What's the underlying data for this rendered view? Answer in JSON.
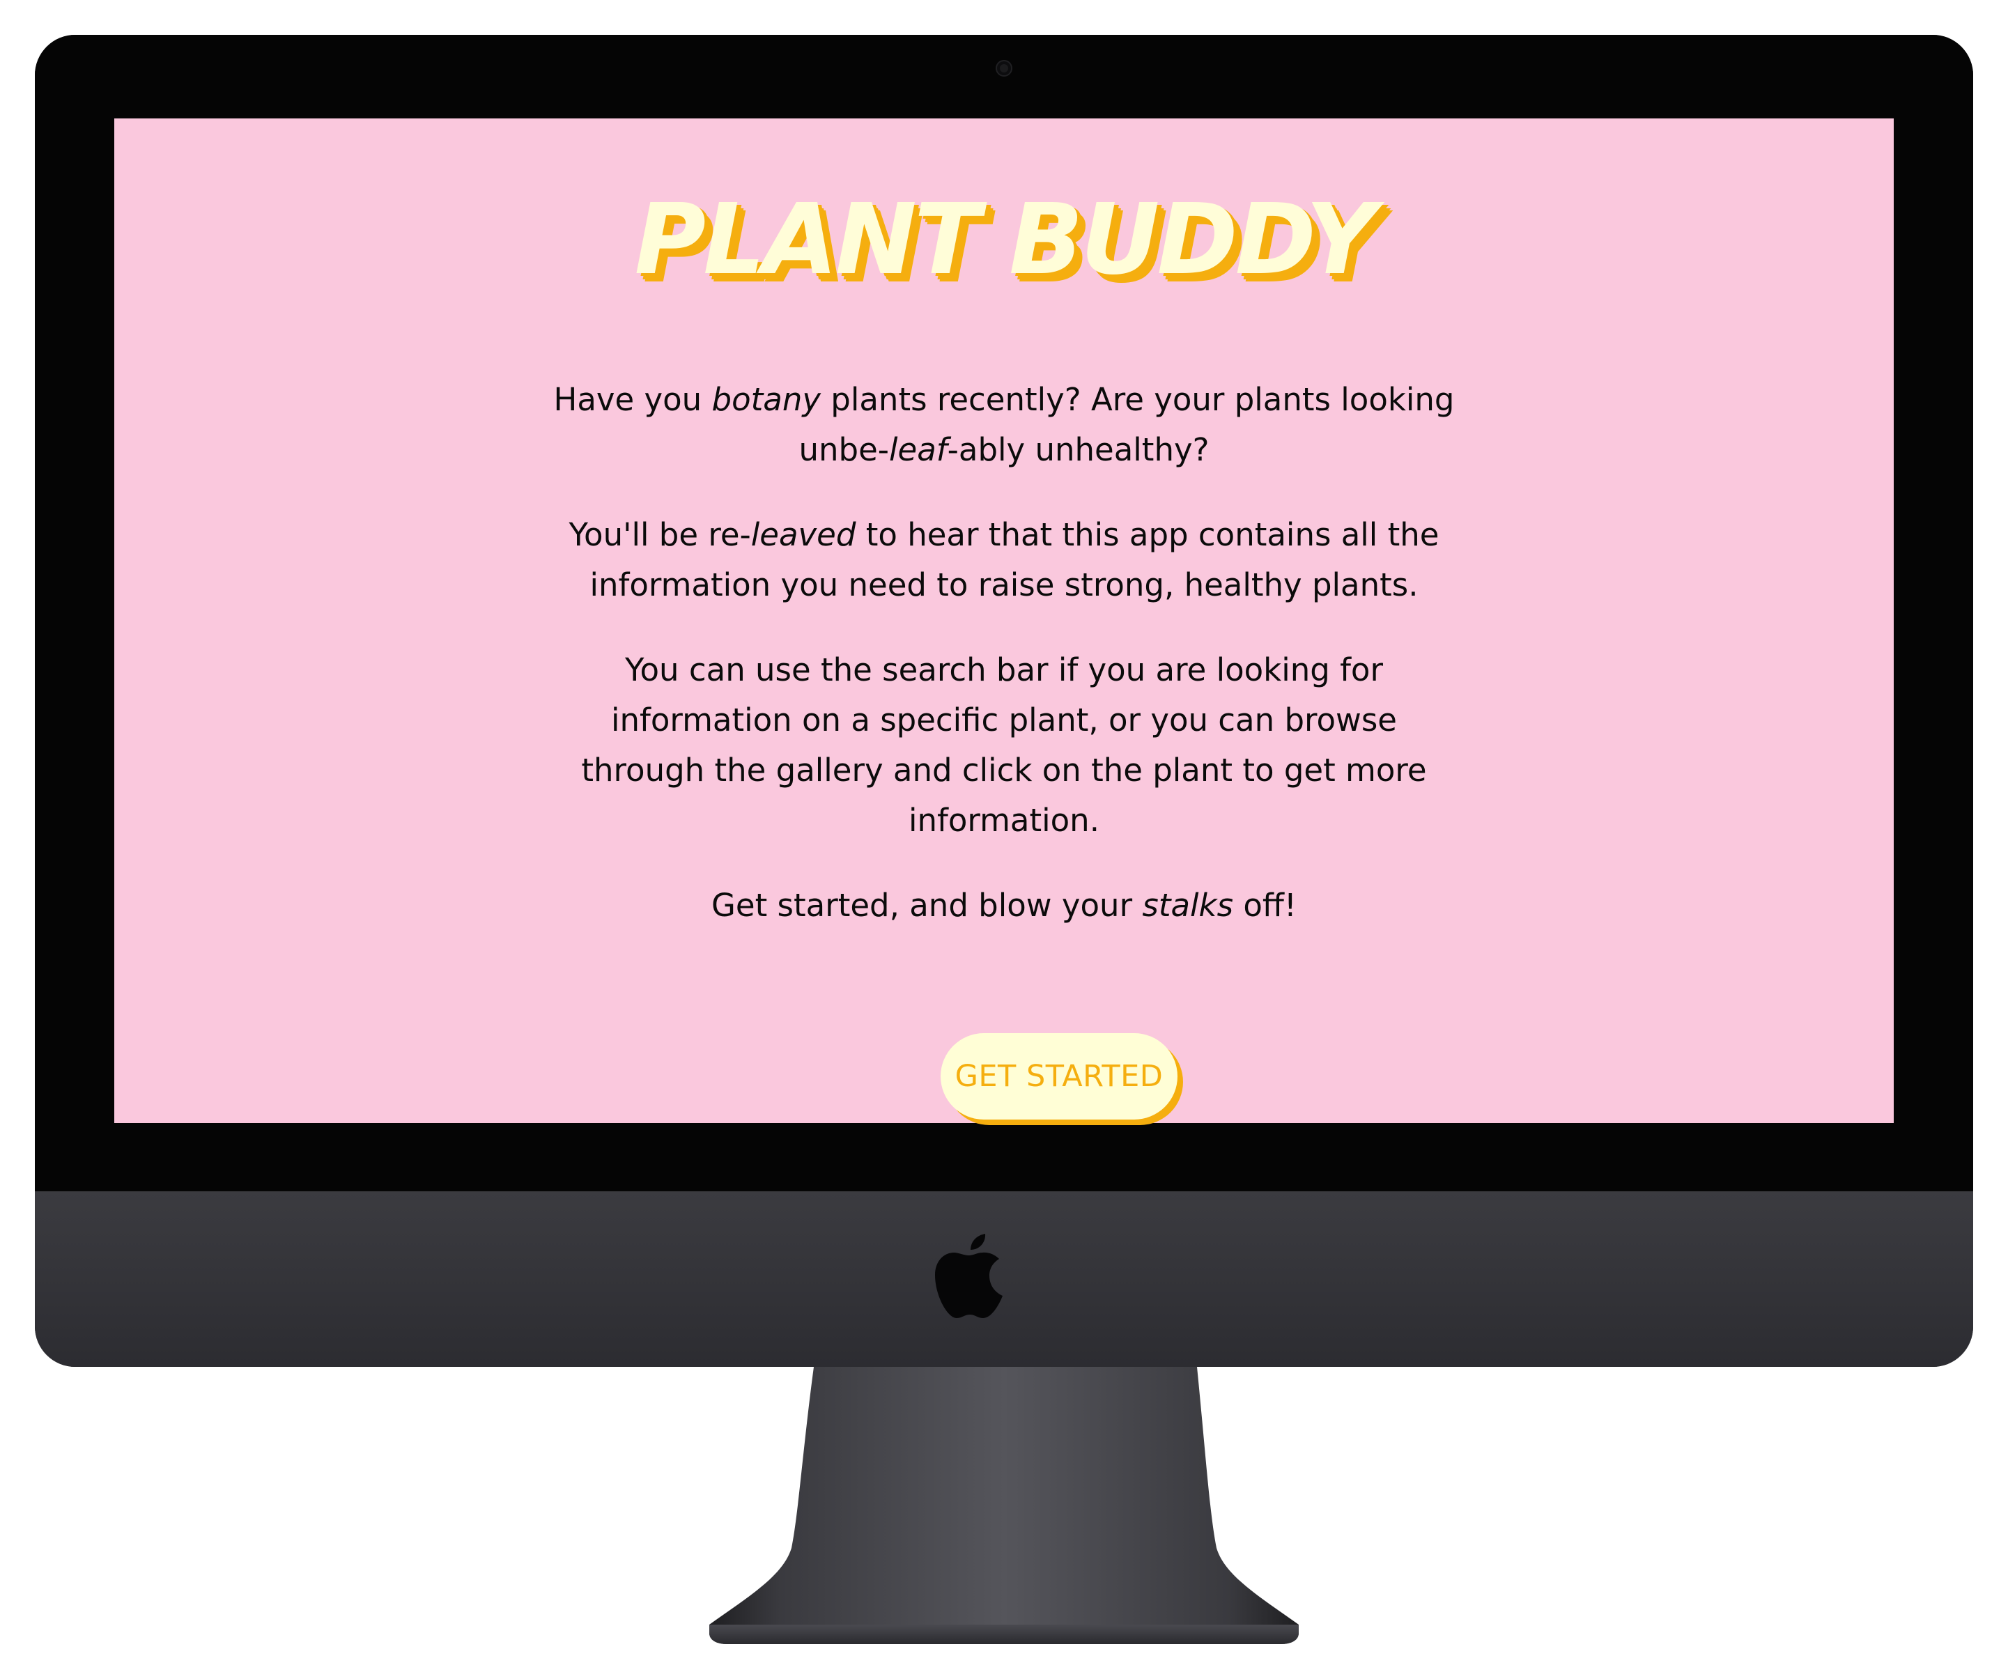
{
  "hero": {
    "title": "PLANT BUDDY"
  },
  "intro": {
    "p1": {
      "a": "Have you ",
      "b": "botany",
      "c": " plants recently? Are your plants looking unbe-",
      "d": "leaf",
      "e": "-ably unhealthy?"
    },
    "p2": {
      "a": "You'll be re-",
      "b": "leaved",
      "c": " to hear that this app contains all the information you need to raise strong, healthy plants."
    },
    "p3": "You can use the search bar if you are looking for information on a specific plant, or you can browse through the gallery and click on the plant to get more information.",
    "p4": {
      "a": "Get started, and blow your ",
      "b": "stalks",
      "c": " off!"
    }
  },
  "cta": {
    "label": "GET STARTED"
  },
  "colors": {
    "screen_background": "#fac8dd",
    "title_fill": "#fffdd8",
    "accent_orange": "#f5ae0f",
    "body_text": "#0b0b0b",
    "device_bezel": "#050505",
    "device_chin": "#38383d"
  },
  "icons": {
    "device_logo": "apple-logo-icon",
    "camera": "camera-icon"
  }
}
